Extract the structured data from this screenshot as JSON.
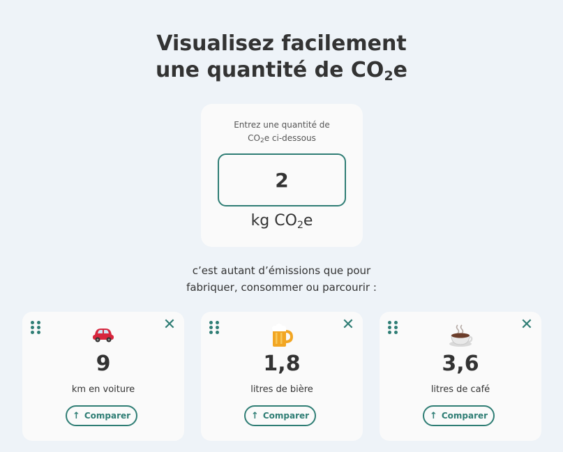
{
  "header": {
    "title_line1": "Visualisez facilement",
    "title_line2_prefix": "une quantité de CO",
    "title_sub": "2",
    "title_suffix": "e"
  },
  "input": {
    "label_line1": "Entrez une quantité de",
    "label_line2_prefix": "CO",
    "label_line2_sub": "2",
    "label_line2_suffix": "e ci-dessous",
    "value": "2",
    "unit_prefix": "kg CO",
    "unit_sub": "2",
    "unit_suffix": "e"
  },
  "intro": {
    "line1": "c’est autant d’émissions que pour",
    "line2": "fabriquer, consommer ou parcourir :"
  },
  "cards": [
    {
      "icon": "car-icon",
      "value": "9",
      "label": "km en voiture",
      "button": "Comparer"
    },
    {
      "icon": "beer-mug-icon",
      "value": "1,8",
      "label": "litres de bière",
      "button": "Comparer"
    },
    {
      "icon": "coffee-cup-icon",
      "value": "3,6",
      "label": "litres de café",
      "button": "Comparer"
    }
  ],
  "colors": {
    "accent": "#2e7d74",
    "background": "#eef3f8",
    "card": "#fafafa"
  }
}
